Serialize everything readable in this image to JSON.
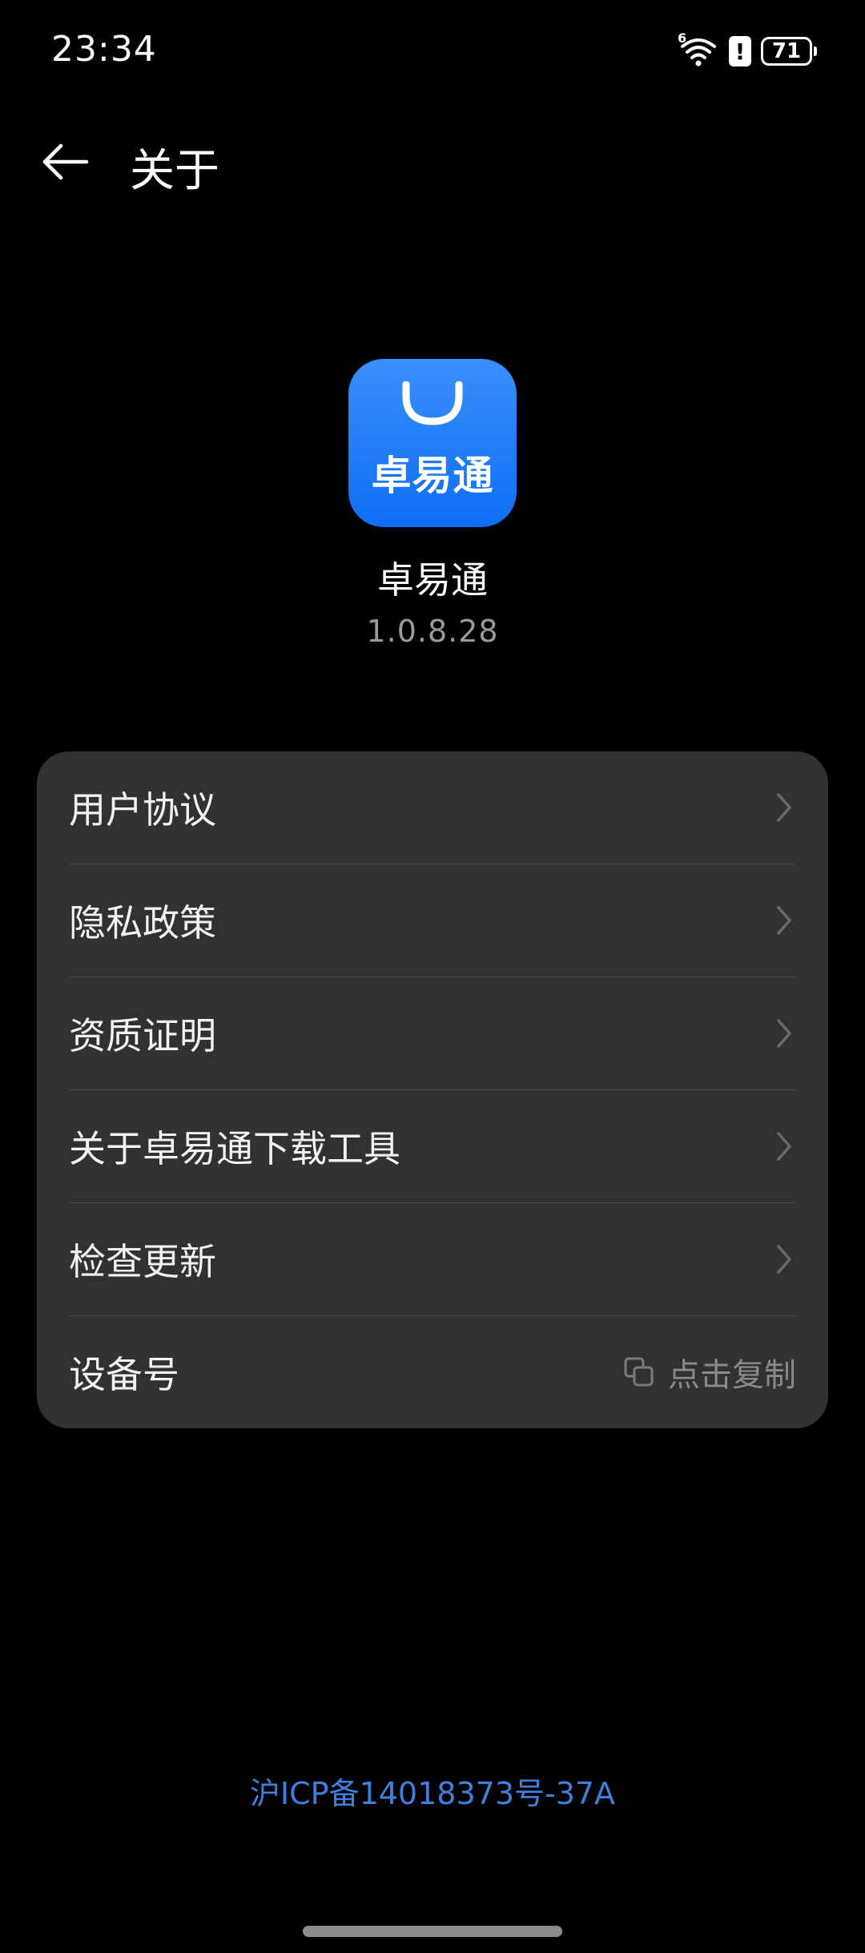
{
  "status_bar": {
    "time": "23:34",
    "network_label": "6",
    "battery_level": "71"
  },
  "header": {
    "title": "关于"
  },
  "app": {
    "icon_text": "卓易通",
    "name": "卓易通",
    "version": "1.0.8.28"
  },
  "menu": {
    "items": [
      {
        "label": "用户协议"
      },
      {
        "label": "隐私政策"
      },
      {
        "label": "资质证明"
      },
      {
        "label": "关于卓易通下载工具"
      },
      {
        "label": "检查更新"
      }
    ],
    "device_id": {
      "label": "设备号",
      "action_label": "点击复制"
    }
  },
  "footer": {
    "icp": "沪ICP备14018373号-37A"
  },
  "colors": {
    "background": "#000000",
    "card": "#313131",
    "link": "#3f7fe0",
    "app_icon": "#1a7af8"
  }
}
